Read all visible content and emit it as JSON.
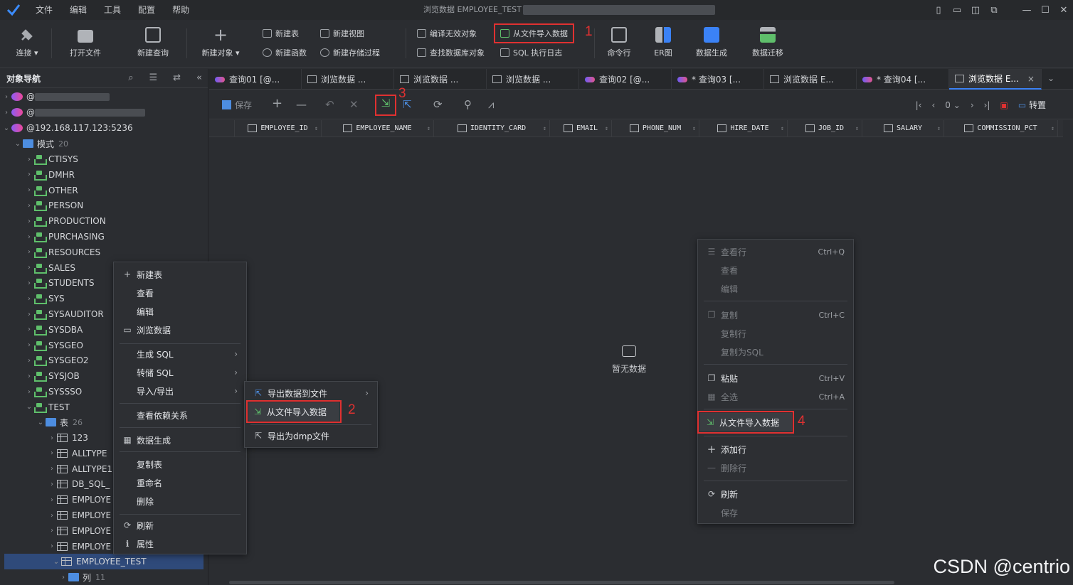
{
  "menubar": {
    "items": [
      "文件",
      "编辑",
      "工具",
      "配置",
      "帮助"
    ]
  },
  "window": {
    "title": "浏览数据 EMPLOYEE_TEST"
  },
  "toolbar": {
    "connect": "连接",
    "open_file": "打开文件",
    "new_query": "新建查询",
    "new_object": "新建对象",
    "new_table": "新建表",
    "new_view": "新建视图",
    "new_function": "新建函数",
    "new_procedure": "新建存储过程",
    "compile_invalid": "编译无效对象",
    "find_db_object": "查找数据库对象",
    "import_from_file": "从文件导入数据",
    "sql_log": "SQL 执行日志",
    "command_line": "命令行",
    "er_diagram": "ER图",
    "data_generation": "数据生成",
    "data_migration": "数据迁移"
  },
  "annotations": {
    "n1": "1",
    "n2": "2",
    "n3": "3",
    "n4": "4"
  },
  "navigator": {
    "title": "对象导航",
    "connection": "@192.168.117.123:5236",
    "conn_prefix": "@",
    "schema_folder": "模式",
    "schema_count": "20",
    "schemas": [
      "CTISYS",
      "DMHR",
      "OTHER",
      "PERSON",
      "PRODUCTION",
      "PURCHASING",
      "RESOURCES",
      "SALES",
      "STUDENTS",
      "SYS",
      "SYSAUDITOR",
      "SYSDBA",
      "SYSGEO",
      "SYSGEO2",
      "SYSJOB",
      "SYSSSO",
      "TEST"
    ],
    "table_folder": "表",
    "table_count": "26",
    "tables": [
      "123",
      "ALLTYPE",
      "ALLTYPE1",
      "DB_SQL_",
      "EMPLOYE",
      "EMPLOYE",
      "EMPLOYE",
      "EMPLOYE",
      "EMPLOYEE_TEST"
    ],
    "column_folder": "列",
    "column_count": "11"
  },
  "tabs": [
    "查询01 [@...",
    "浏览数据 ...",
    "浏览数据 ...",
    "浏览数据 ...",
    "查询02 [@...",
    "* 查询03 [...",
    "浏览数据 E...",
    "* 查询04 [...",
    "浏览数据 E..."
  ],
  "data_toolbar": {
    "save": "保存",
    "page_num": "0",
    "transpose": "转置"
  },
  "columns": [
    "EMPLOYEE_ID",
    "EMPLOYEE_NAME",
    "IDENTITY_CARD",
    "EMAIL",
    "PHONE_NUM",
    "HIRE_DATE",
    "JOB_ID",
    "SALARY",
    "COMMISSION_PCT"
  ],
  "empty_text": "暂无数据",
  "ctx_left": [
    "新建表",
    "查看",
    "编辑",
    "浏览数据",
    "生成 SQL",
    "转储 SQL",
    "导入/导出",
    "查看依赖关系",
    "数据生成",
    "复制表",
    "重命名",
    "删除",
    "刷新",
    "属性"
  ],
  "ctx_sub": [
    "导出数据到文件",
    "从文件导入数据",
    "导出为dmp文件"
  ],
  "ctx_right": {
    "view_row": "查看行",
    "view_row_sc": "Ctrl+Q",
    "view": "查看",
    "edit": "编辑",
    "copy": "复制",
    "copy_sc": "Ctrl+C",
    "copy_row": "复制行",
    "copy_sql": "复制为SQL",
    "paste": "粘贴",
    "paste_sc": "Ctrl+V",
    "select_all": "全选",
    "select_all_sc": "Ctrl+A",
    "import": "从文件导入数据",
    "add_row": "添加行",
    "delete_row": "删除行",
    "refresh": "刷新",
    "save": "保存"
  },
  "watermark": "CSDN @centrio"
}
